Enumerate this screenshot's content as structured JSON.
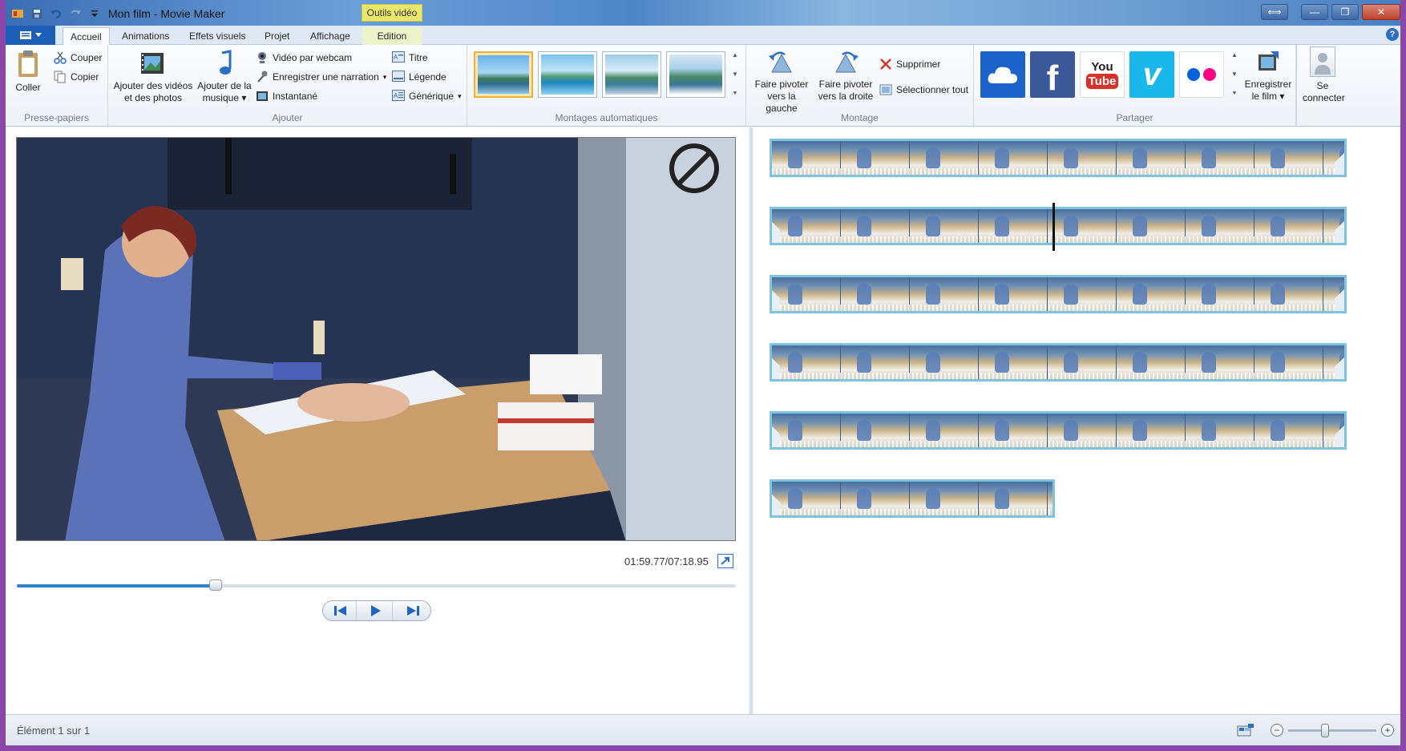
{
  "window": {
    "title": "Mon film - Movie Maker",
    "context_tab_group": "Outils vidéo",
    "controls": {
      "restore": "⟺",
      "minimize": "—",
      "maximize": "❐",
      "close": "✕"
    }
  },
  "tabs": [
    {
      "label": "Accueil",
      "active": true
    },
    {
      "label": "Animations"
    },
    {
      "label": "Effets visuels"
    },
    {
      "label": "Projet"
    },
    {
      "label": "Affichage"
    },
    {
      "label": "Edition",
      "context": true
    }
  ],
  "ribbon": {
    "clipboard": {
      "label": "Presse-papiers",
      "paste": "Coller",
      "cut": "Couper",
      "copy": "Copier"
    },
    "add": {
      "label": "Ajouter",
      "add_videos_line1": "Ajouter des vidéos",
      "add_videos_line2": "et des photos",
      "add_music_line1": "Ajouter de la",
      "add_music_line2": "musique",
      "webcam": "Vidéo par webcam",
      "narration": "Enregistrer une narration",
      "snapshot": "Instantané",
      "title": "Titre",
      "caption": "Légende",
      "credits": "Générique"
    },
    "automovie": {
      "label": "Montages automatiques"
    },
    "editing": {
      "label": "Montage",
      "rotate_left_line1": "Faire pivoter",
      "rotate_left_line2": "vers la gauche",
      "rotate_right_line1": "Faire pivoter",
      "rotate_right_line2": "vers la droite",
      "delete": "Supprimer",
      "select_all": "Sélectionner tout"
    },
    "share": {
      "label": "Partager",
      "services": [
        "onedrive",
        "facebook",
        "youtube",
        "vimeo",
        "flickr"
      ],
      "youtube_line1": "You",
      "youtube_line2": "Tube",
      "facebook_glyph": "f",
      "vimeo_glyph": "v",
      "save_movie_line1": "Enregistrer",
      "save_movie_line2": "le film",
      "signin_line1": "Se",
      "signin_line2": "connecter"
    }
  },
  "preview": {
    "timecode": "01:59.77/07:18.95",
    "progress": 0.277
  },
  "status": {
    "text": "Élément 1 sur 1",
    "zoom_level": 0.42
  },
  "colors": {
    "accent": "#2f7fd0",
    "file_menu": "#1c5fb8",
    "track_border": "#7ec3e0",
    "context_tab": "#eae86a",
    "frame_purple": "#8a47a8"
  }
}
